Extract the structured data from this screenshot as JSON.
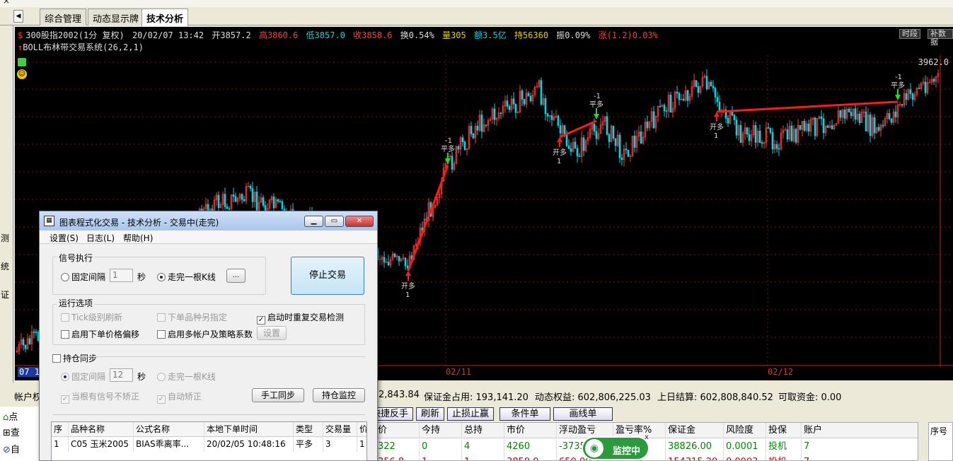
{
  "tabs": [
    "综合管理",
    "动态显示牌",
    "技术分析"
  ],
  "left_strip": [
    "测",
    "统",
    "证"
  ],
  "chart": {
    "info": {
      "symbol": "300股指2002(1分 复权)",
      "datetime": "20/02/07 13:42",
      "open": "开3857.2",
      "high": "高3860.6",
      "low": "低3857.0",
      "close": "收3858.6",
      "turnover": "换0.54%",
      "volume": "量305",
      "amount": "额3.5亿",
      "hold": "持56360",
      "amplitude": "振0.09%",
      "change": "涨(1.2)0.03%"
    },
    "formula": "BOLL布林带交易系统(26,2,1)",
    "btn_period": "时段",
    "btn_supplement": "补数据",
    "ymax": "3962.0",
    "xlabels": [
      "07 1",
      "02/11",
      "02/12"
    ],
    "signals": [
      {
        "line1": "开多",
        "line2": "1"
      },
      {
        "line1": "-1",
        "line2": "平多"
      },
      {
        "line1": "开多",
        "line2": "1"
      },
      {
        "line1": "-1",
        "line2": "平多"
      },
      {
        "line1": "开多",
        "line2": "1"
      },
      {
        "line1": "-1",
        "line2": "平多"
      }
    ],
    "colors": {
      "up": "#ff3b3b",
      "down": "#00d8e8",
      "grid": "#7a1010",
      "trade": "#ff1a1a",
      "sell_arrow": "#1fe01f"
    }
  },
  "account": {
    "label": "帐户权",
    "equity_partial": "2,843.84",
    "margin": "保证金占用: 193,141.20",
    "dynamic": "动态权益: 602,806,225.03",
    "prev_settle": "上日结算: 602,808,840.52",
    "available": "可取资金: 0.00"
  },
  "bottom_left": [
    "点",
    "查",
    "自"
  ],
  "order_buttons": [
    "快捷反手",
    "刷新",
    "止损止赢",
    "条件单",
    "画线单"
  ],
  "positions": {
    "headers": [
      "价",
      "今持",
      "总持",
      "市价",
      "浮动盈亏",
      "盈亏率%",
      "保证金",
      "风险度",
      "投保",
      "账户"
    ],
    "rows": [
      [
        "322",
        "0",
        "4",
        "4260",
        "-3735",
        "",
        "38826.00",
        "0.0001",
        "投机",
        "7"
      ],
      [
        "356.8",
        "1",
        "1",
        "3859.0",
        "650.00",
        "",
        "154315.20",
        "0.0003",
        "投机",
        "7"
      ]
    ]
  },
  "right_panel": {
    "header": "序号"
  },
  "monitor": {
    "label": "监控中",
    "close": "x"
  },
  "dialog": {
    "title": "图表程式化交易 - 技术分析 - 交易中(走完)",
    "menu": [
      "设置(S)",
      "日志(L)",
      "帮助(H)"
    ],
    "signal_group": "信号执行",
    "fixed_interval": "固定间隔",
    "interval_value": "1",
    "seconds": "秒",
    "walk_kline": "走完一根K线",
    "ellipsis": "...",
    "stop_trade": "停止交易",
    "run_group": "运行选项",
    "tick_refresh": "Tick级别刷新",
    "order_other": "下单品种另指定",
    "startup_check": "启动时重复交易检测",
    "price_offset": "启用下单价格偏移",
    "multi_account": "启用多帐户及策略系数",
    "settings": "设置",
    "hold_sync": "持仓同步",
    "fixed_interval2": "固定间隔",
    "interval_value2": "12",
    "seconds2": "秒",
    "walk_kline2": "走完一根K线",
    "no_correct": "当根有信号不矫正",
    "auto_correct": "自动矫正",
    "manual_sync": "手工同步",
    "hold_monitor": "持仓监控",
    "log": {
      "headers": [
        "序",
        "品种名称",
        "公式名称",
        "本地下单时间",
        "类型",
        "交易量",
        "价"
      ],
      "rows": [
        [
          "1",
          "C05 玉米2005",
          "BIAS乖离率...",
          "20/02/05 10:48:16",
          "平多",
          "3",
          "1"
        ]
      ]
    }
  }
}
